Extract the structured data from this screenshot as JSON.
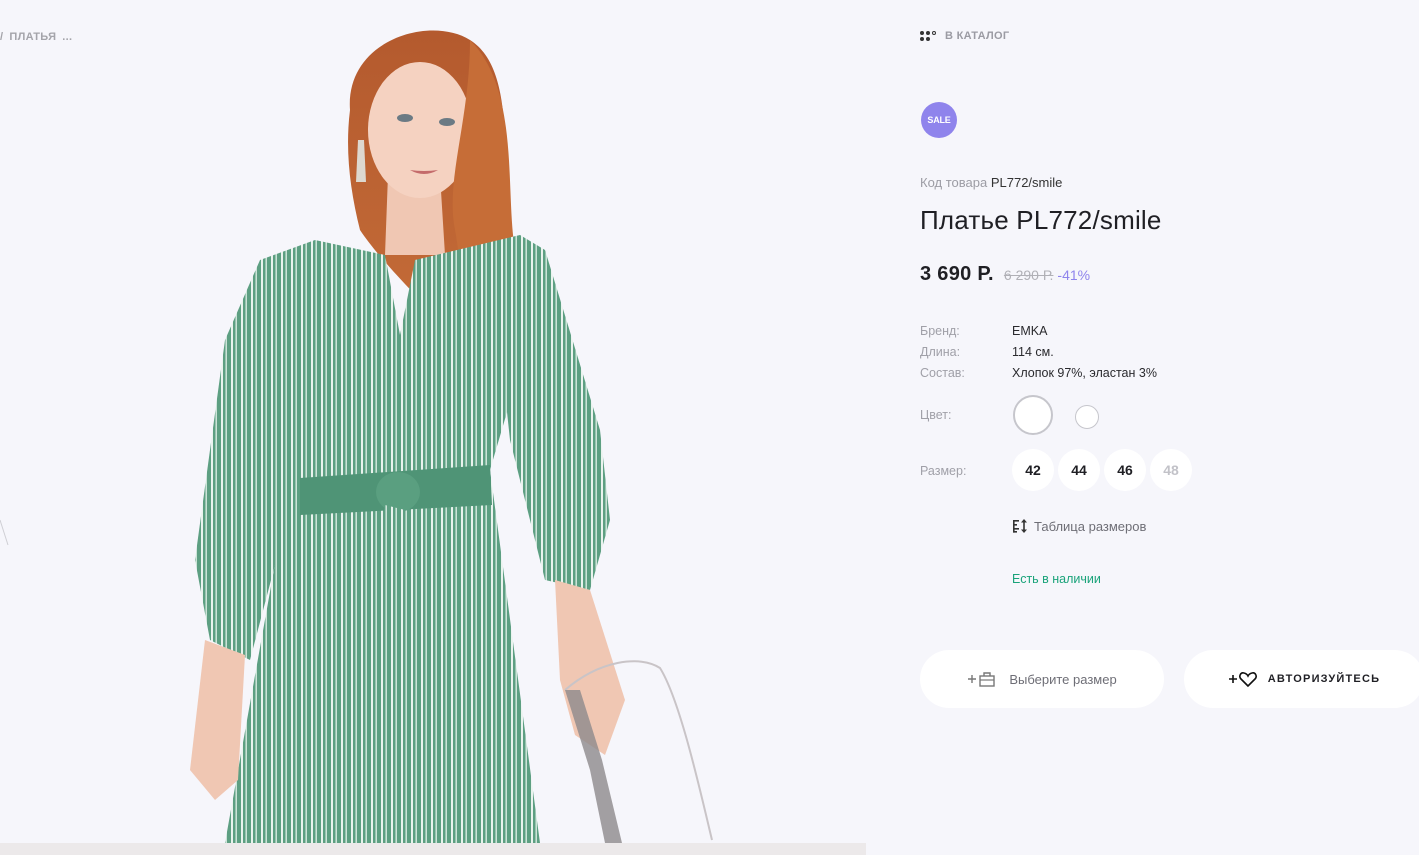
{
  "breadcrumb": {
    "separator": "/",
    "current": "ПЛАТЬЯ",
    "more": "..."
  },
  "catalog_link": {
    "label": "В КАТАЛОГ",
    "icon": "grid-dots-icon"
  },
  "product": {
    "badge": "SALE",
    "sku_label": "Код товара",
    "sku_value": "PL772/smile",
    "title": "Платье PL772/smile",
    "price_current": "3 690 Р.",
    "price_old": "6 290 Р.",
    "discount": "-41%",
    "properties": [
      {
        "key": "Бренд:",
        "value": "EMKA"
      },
      {
        "key": "Длина:",
        "value": "114 см."
      },
      {
        "key": "Состав:",
        "value": "Хлопок 97%, эластан 3%"
      }
    ],
    "color_label": "Цвет:",
    "colors": [
      {
        "name": "white",
        "hex": "#ffffff",
        "selected": true
      },
      {
        "name": "white",
        "hex": "#ffffff",
        "selected": false
      }
    ],
    "size_label": "Размер:",
    "sizes": [
      {
        "label": "42",
        "available": true
      },
      {
        "label": "44",
        "available": true
      },
      {
        "label": "46",
        "available": true
      },
      {
        "label": "48",
        "available": false
      }
    ],
    "size_table_label": "Таблица размеров",
    "stock_status": "Есть в наличии"
  },
  "actions": {
    "cart_button": "Выберите размер",
    "wishlist_button": "АВТОРИЗУЙТЕСЬ"
  },
  "colors": {
    "accent": "#8f84ec",
    "in_stock": "#1aa37a",
    "background": "#f6f6fb",
    "dress": "#5a9f80"
  }
}
